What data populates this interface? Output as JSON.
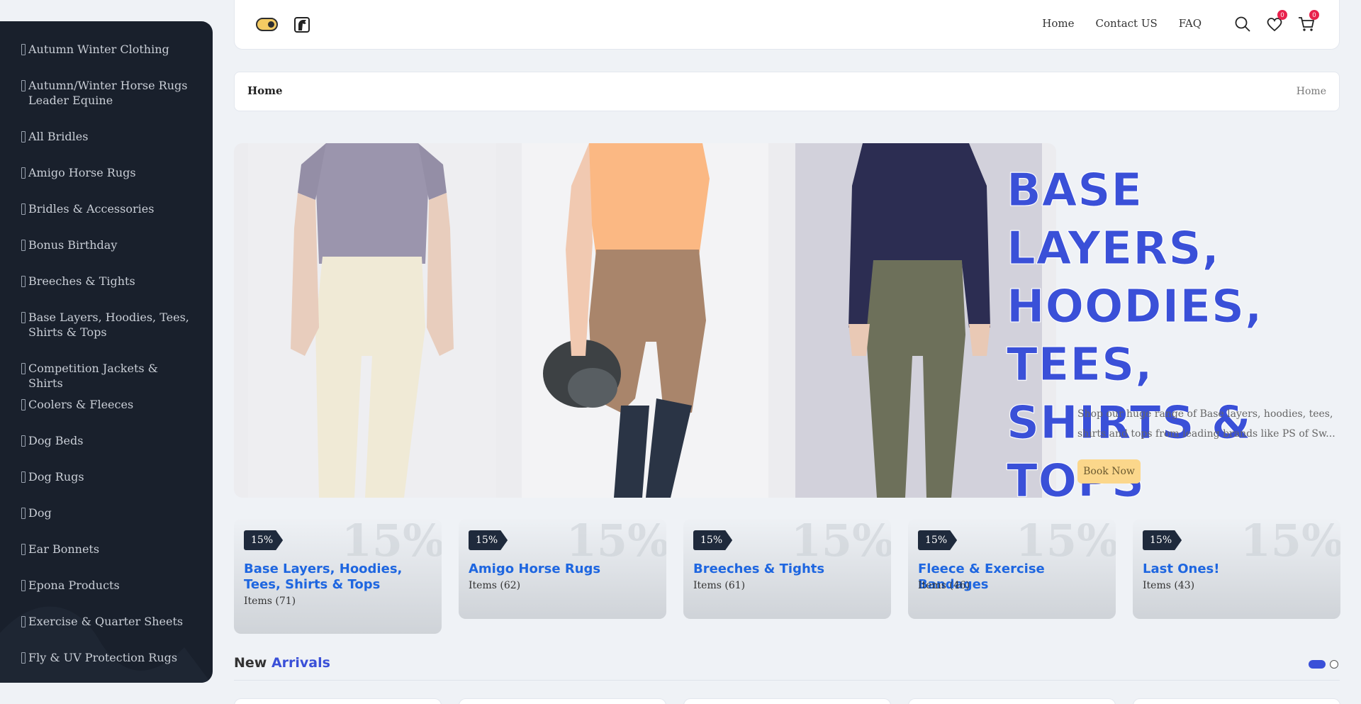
{
  "sidebar": {
    "items": [
      {
        "label": "Autumn Winter Clothing",
        "tall": false
      },
      {
        "label": "Autumn/Winter Horse Rugs Leader Equine",
        "tall": true
      },
      {
        "label": "All Bridles",
        "tall": false
      },
      {
        "label": "Amigo Horse Rugs",
        "tall": false
      },
      {
        "label": "Bridles & Accessories",
        "tall": false
      },
      {
        "label": "Bonus Birthday",
        "tall": false
      },
      {
        "label": "Breeches & Tights",
        "tall": false
      },
      {
        "label": "Base Layers, Hoodies, Tees, Shirts & Tops",
        "tall": true
      },
      {
        "label": "Competition Jackets & Shirts",
        "tall": false
      },
      {
        "label": "Coolers & Fleeces",
        "tall": false
      },
      {
        "label": "Dog Beds",
        "tall": false
      },
      {
        "label": "Dog Rugs",
        "tall": false
      },
      {
        "label": "Dog",
        "tall": false
      },
      {
        "label": "Ear Bonnets",
        "tall": false
      },
      {
        "label": "Epona Products",
        "tall": false
      },
      {
        "label": "Exercise & Quarter Sheets",
        "tall": false
      },
      {
        "label": "Fly & UV Protection Rugs",
        "tall": false
      }
    ]
  },
  "header": {
    "nav": [
      "Home",
      "Contact US",
      "FAQ"
    ],
    "wishlist_count": "0",
    "cart_count": "0",
    "icons": [
      "theme-toggle",
      "horse-logo-icon",
      "search-icon",
      "heart-icon",
      "cart-icon"
    ]
  },
  "breadcrumb": {
    "title": "Home",
    "path": "Home"
  },
  "hero": {
    "title": "BASE LAYERS, HOODIES, TEES, SHIRTS & TOPS",
    "description": "Shop our huge range of Base layers, hoodies, tees, shirts and tops from leading brands like PS of Sw...",
    "button": "Book Now"
  },
  "categories": [
    {
      "discount": "15%",
      "title": "Base Layers, Hoodies, Tees, Shirts & Tops",
      "items": "Items (71)"
    },
    {
      "discount": "15%",
      "title": "Amigo Horse Rugs",
      "items": "Items (62)"
    },
    {
      "discount": "15%",
      "title": "Breeches & Tights",
      "items": "Items (61)"
    },
    {
      "discount": "15%",
      "title": "Fleece & Exercise Bandages",
      "items": "Items (46)"
    },
    {
      "discount": "15%",
      "title": "Last Ones!",
      "items": "Items (43)"
    }
  ],
  "arrivals": {
    "word1": "New",
    "word2": "Arrivals"
  },
  "colors": {
    "accent": "#3a50d8",
    "sidebar_bg": "#19202c",
    "link_blue": "#1e66e0",
    "button_yellow": "#fbd78b",
    "badge_red": "#e8214c"
  }
}
